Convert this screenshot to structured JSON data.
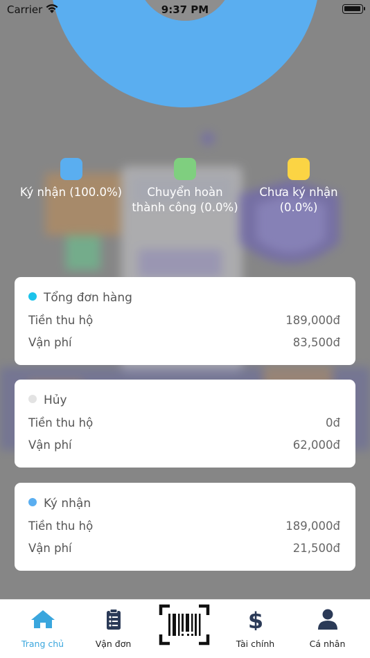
{
  "status_bar": {
    "carrier": "Carrier",
    "time": "9:37 PM"
  },
  "chart_data": {
    "type": "pie",
    "categories": [
      "Ký nhận",
      "Chuyển hoàn thành công",
      "Chưa ký nhận"
    ],
    "values": [
      100.0,
      0.0,
      0.0
    ],
    "colors": [
      "#5aaef0",
      "#7fcf7f",
      "#fbd444"
    ]
  },
  "legend": [
    {
      "line1": "Ký nhận (100.0%)",
      "line2": "",
      "color": "#5aaef0"
    },
    {
      "line1": "Chuyển hoàn",
      "line2": "thành công (0.0%)",
      "color": "#7fcf7f"
    },
    {
      "line1": "Chưa ký nhận",
      "line2": "(0.0%)",
      "color": "#fbd444"
    }
  ],
  "cards": [
    {
      "title": "Tổng đơn hàng",
      "dot_color": "#1cc3eb",
      "cod_label": "Tiền thu hộ",
      "cod_value": "189,000đ",
      "fee_label": "Vận phí",
      "fee_value": "83,500đ"
    },
    {
      "title": "Hủy",
      "dot_color": "#e3e3e3",
      "cod_label": "Tiền thu hộ",
      "cod_value": "0đ",
      "fee_label": "Vận phí",
      "fee_value": "62,000đ"
    },
    {
      "title": "Ký nhận",
      "dot_color": "#5aaef0",
      "cod_label": "Tiền thu hộ",
      "cod_value": "189,000đ",
      "fee_label": "Vận phí",
      "fee_value": "21,500đ"
    }
  ],
  "tabs": [
    {
      "label": "Trang chủ",
      "icon": "home-icon",
      "active": true
    },
    {
      "label": "Vận đơn",
      "icon": "clipboard-list-icon",
      "active": false
    },
    {
      "label": "",
      "icon": "barcode-scan-icon",
      "active": false
    },
    {
      "label": "Tài chính",
      "icon": "dollar-icon",
      "active": false
    },
    {
      "label": "Cá nhân",
      "icon": "user-icon",
      "active": false
    }
  ],
  "colors": {
    "active_tab": "#3aa6dd",
    "icon_dark": "#2b3a57",
    "page_overlay": "#8e8e8e"
  }
}
